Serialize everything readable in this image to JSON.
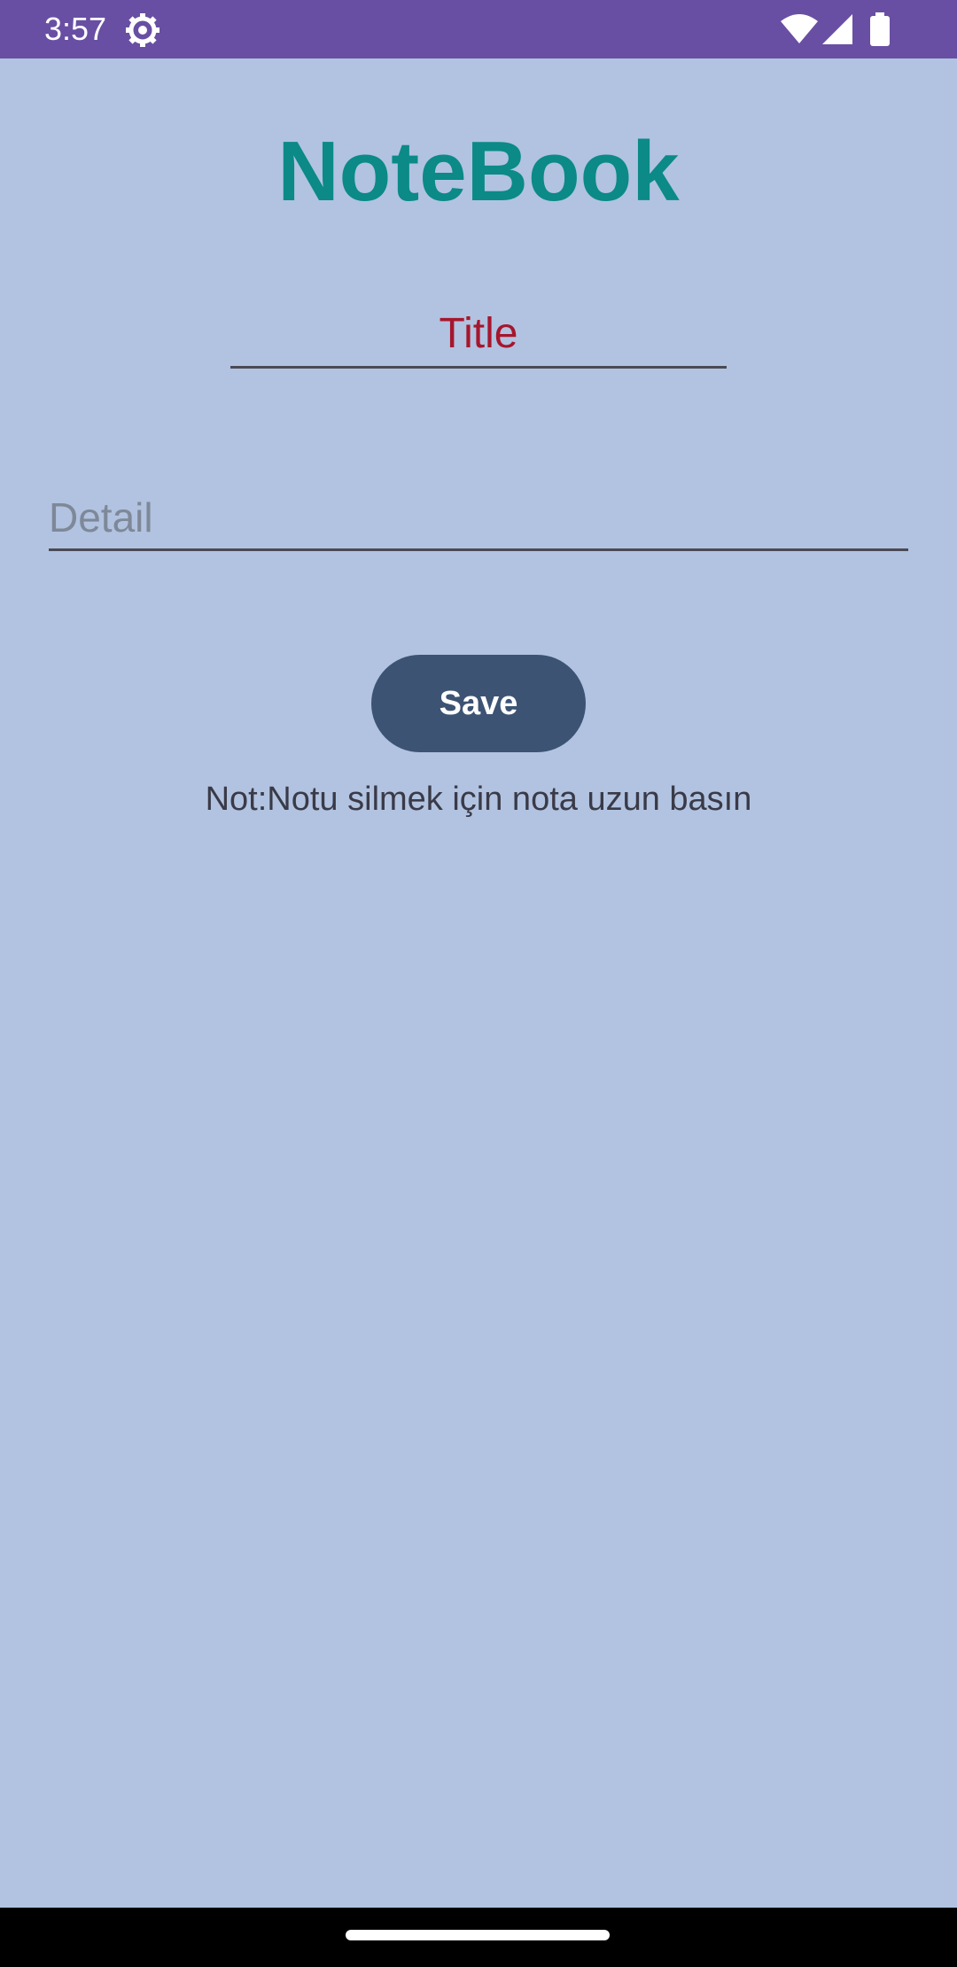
{
  "status_bar": {
    "time": "3:57",
    "icons": [
      "gear-icon",
      "wifi-icon",
      "signal-icon",
      "battery-icon"
    ],
    "background_color": "#684fa3"
  },
  "app": {
    "title": "NoteBook",
    "title_color": "#0b8a87",
    "background_color": "#b1c3e0"
  },
  "title_input": {
    "value": "Title",
    "text_color": "#a6162d"
  },
  "detail_input": {
    "placeholder": "Detail",
    "value": ""
  },
  "save_button": {
    "label": "Save",
    "background_color": "#3d5374"
  },
  "hint": "Not:Notu silmek için nota uzun basın"
}
